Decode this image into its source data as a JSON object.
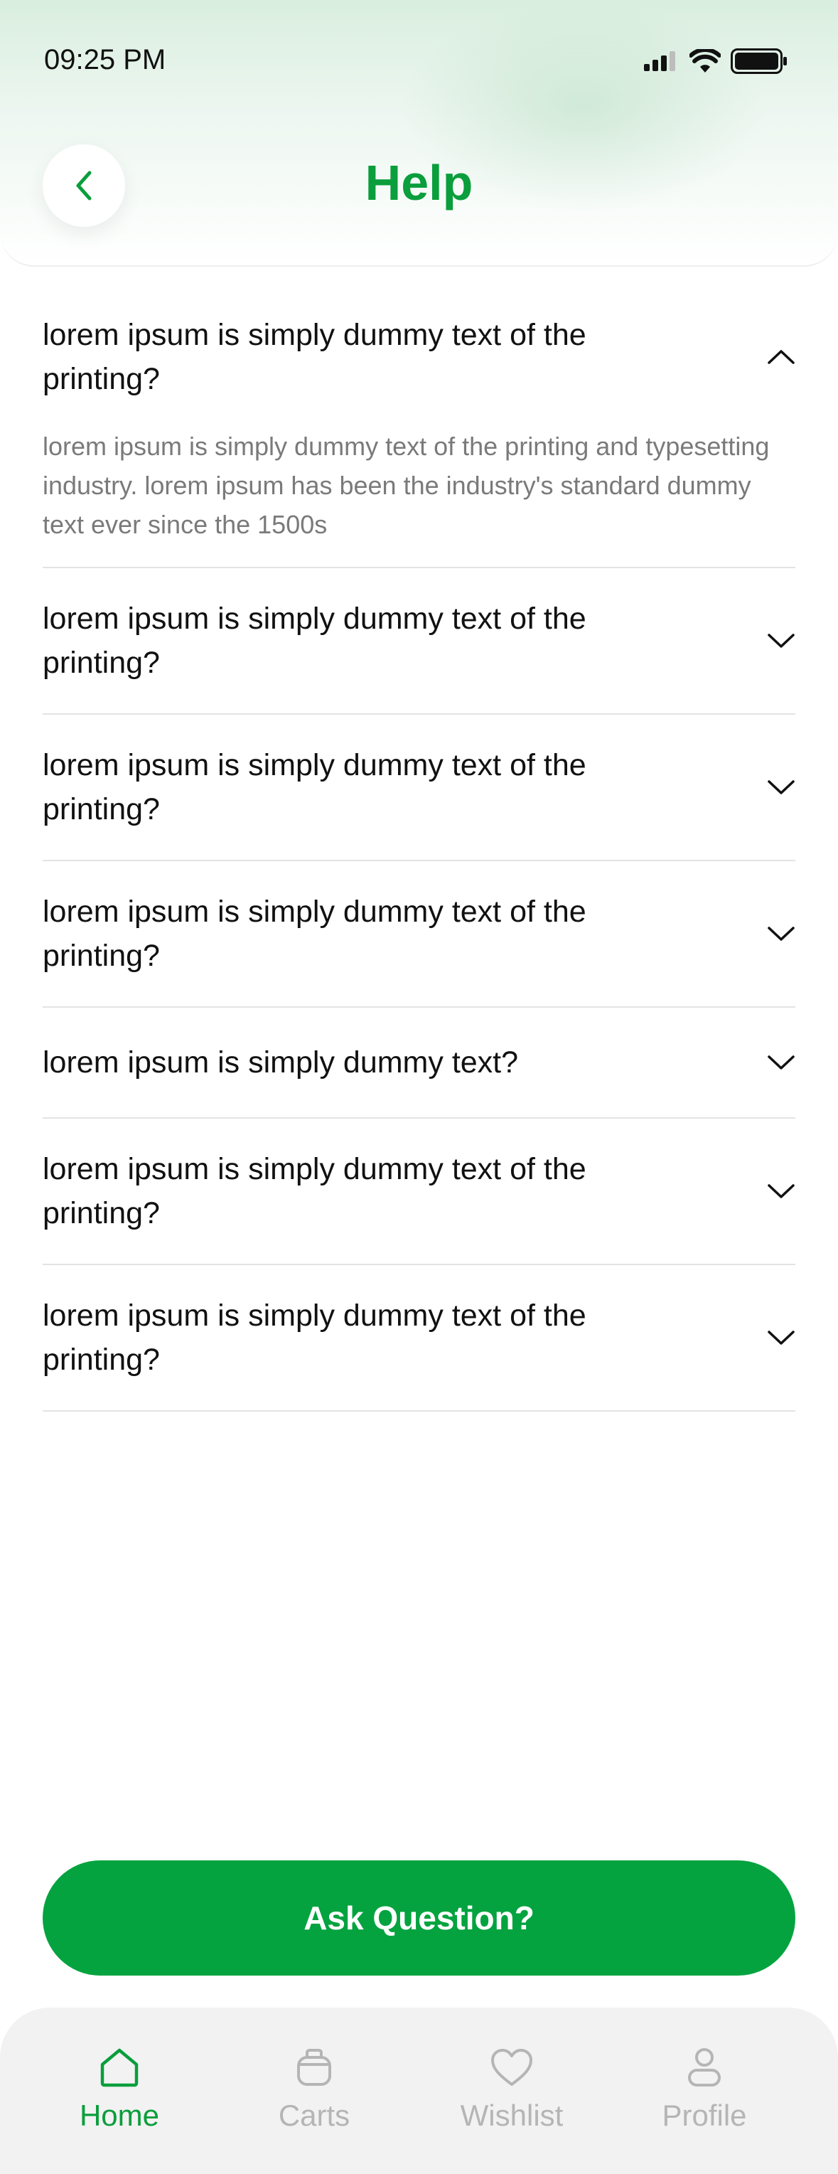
{
  "status_bar": {
    "time": "09:25 PM"
  },
  "header": {
    "title": "Help",
    "back_icon": "chevron-left-icon"
  },
  "colors": {
    "accent": "#0a9e3c",
    "button": "#04a33f",
    "nav_inactive": "#b5b5b5"
  },
  "faq": {
    "items": [
      {
        "question": "lorem ipsum is simply dummy text of the printing?",
        "answer": "lorem ipsum is simply dummy text of the printing and typesetting industry. lorem ipsum has been the industry's standard dummy text ever since the 1500s",
        "expanded": true
      },
      {
        "question": "lorem ipsum is simply dummy text of the printing?",
        "expanded": false
      },
      {
        "question": "lorem ipsum is simply dummy text of the printing?",
        "expanded": false
      },
      {
        "question": "lorem ipsum is simply dummy text of the printing?",
        "expanded": false
      },
      {
        "question": "lorem ipsum is simply dummy text?",
        "expanded": false
      },
      {
        "question": "lorem ipsum is simply dummy text of the printing?",
        "expanded": false
      },
      {
        "question": "lorem ipsum is simply dummy text of the printing?",
        "expanded": false
      }
    ]
  },
  "ask_button": {
    "label": "Ask Question?"
  },
  "bottom_nav": {
    "items": [
      {
        "label": "Home",
        "icon": "home-icon",
        "active": true
      },
      {
        "label": "Carts",
        "icon": "cart-icon",
        "active": false
      },
      {
        "label": "Wishlist",
        "icon": "heart-icon",
        "active": false
      },
      {
        "label": "Profile",
        "icon": "user-icon",
        "active": false
      }
    ]
  }
}
